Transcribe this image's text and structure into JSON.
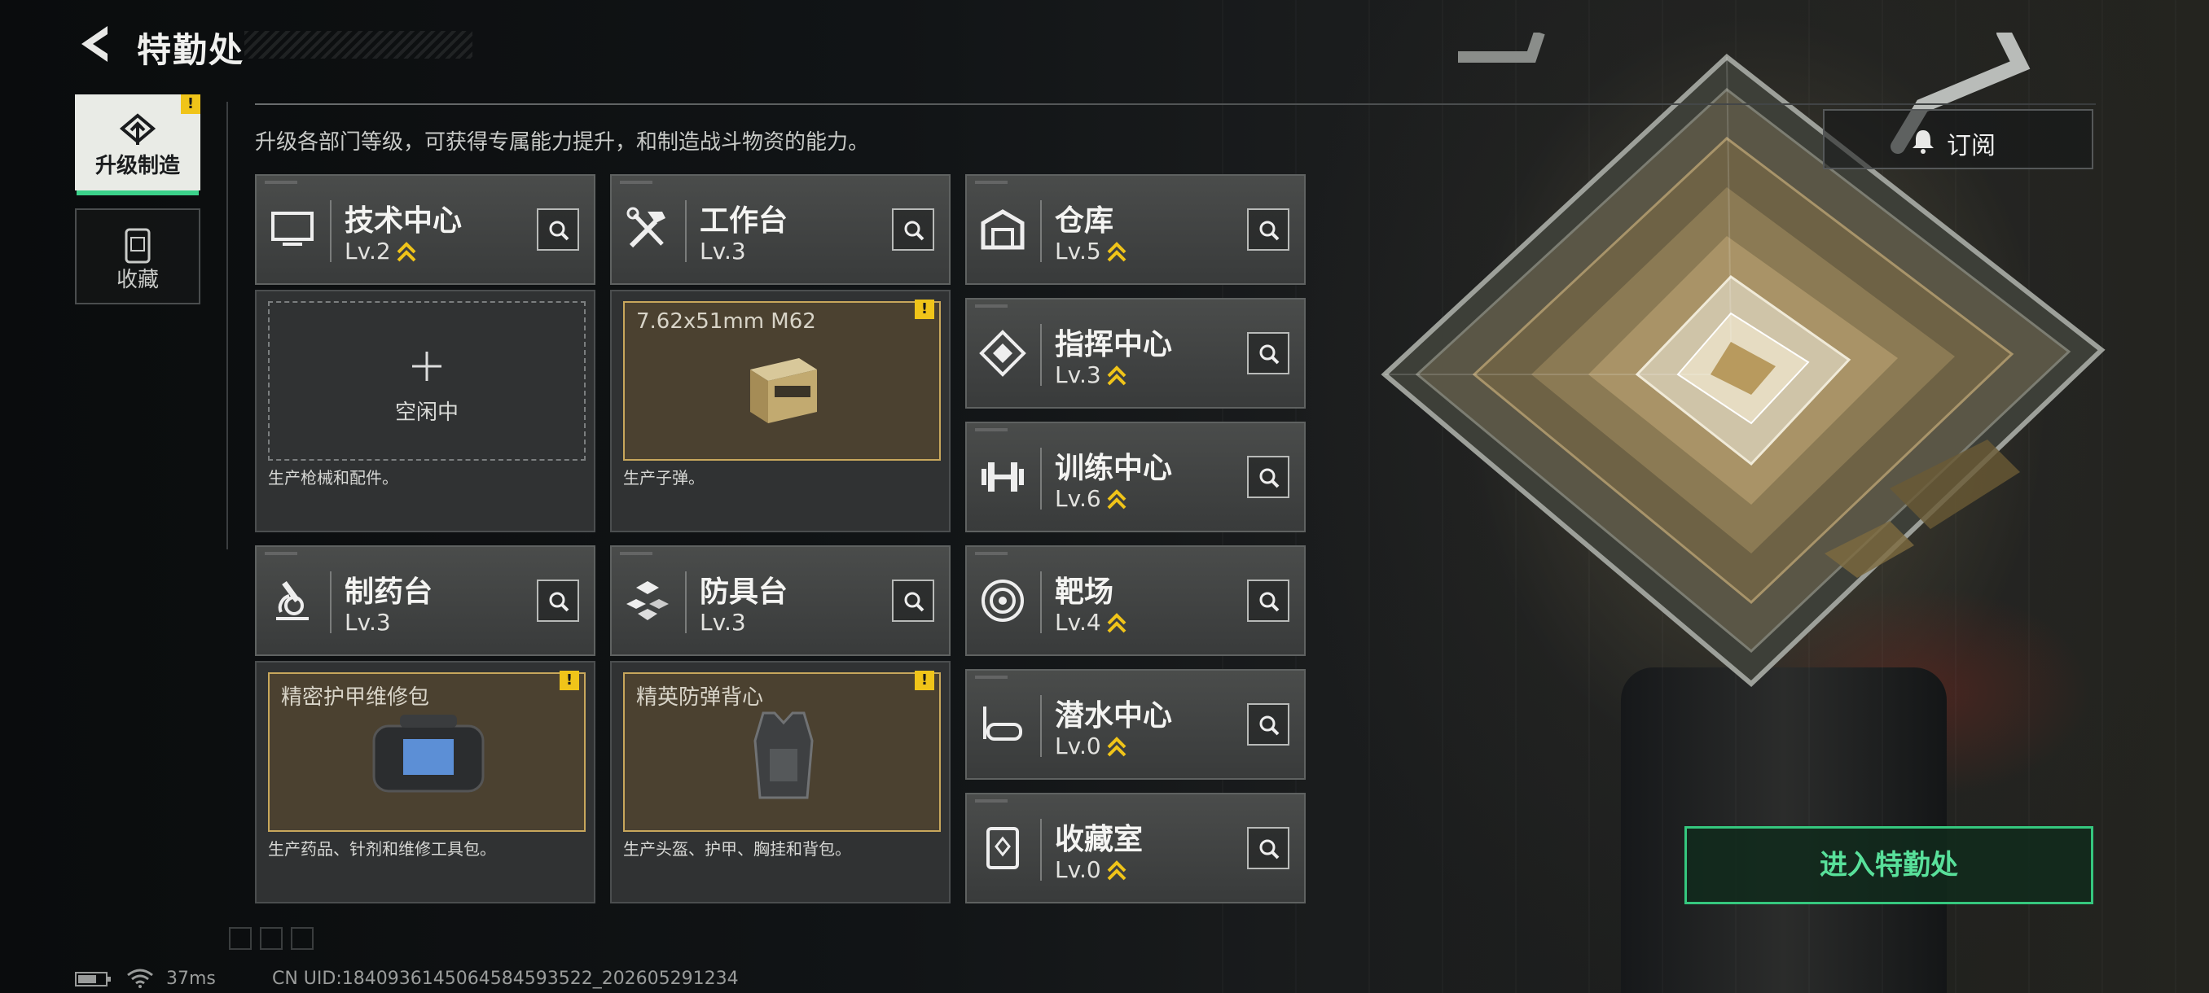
{
  "header": {
    "title": "特勤处"
  },
  "tabs": [
    {
      "label": "升级制造",
      "active": true,
      "alert": "!"
    },
    {
      "label": "收藏",
      "active": false
    }
  ],
  "subtitle": "升级各部门等级，可获得专属能力提升，和制造战斗物资的能力。",
  "subscribe_label": "订阅",
  "enter_label": "进入特勤处",
  "colors": {
    "accent_green": "#3bd18a",
    "alert_yellow": "#f0c419",
    "level_up_gold": "#f0c419",
    "production_border": "#c8a75c"
  },
  "departments": [
    {
      "name": "技术中心",
      "level": "Lv.2",
      "upgradeable": true,
      "icon": "monitor-icon"
    },
    {
      "name": "工作台",
      "level": "Lv.3",
      "upgradeable": false,
      "icon": "tools-icon"
    },
    {
      "name": "仓库",
      "level": "Lv.5",
      "upgradeable": true,
      "icon": "warehouse-icon"
    },
    {
      "name": "指挥中心",
      "level": "Lv.3",
      "upgradeable": true,
      "icon": "command-icon"
    },
    {
      "name": "训练中心",
      "level": "Lv.6",
      "upgradeable": true,
      "icon": "dumbbell-icon"
    },
    {
      "name": "制药台",
      "level": "Lv.3",
      "upgradeable": false,
      "icon": "microscope-icon"
    },
    {
      "name": "防具台",
      "level": "Lv.3",
      "upgradeable": false,
      "icon": "armor-blocks-icon"
    },
    {
      "name": "靶场",
      "level": "Lv.4",
      "upgradeable": true,
      "icon": "target-icon"
    },
    {
      "name": "潜水中心",
      "level": "Lv.0",
      "upgradeable": true,
      "icon": "diving-mask-icon"
    },
    {
      "name": "收藏室",
      "level": "Lv.0",
      "upgradeable": true,
      "icon": "collection-icon"
    }
  ],
  "production": {
    "tech": {
      "status": "空闲中",
      "desc": "生产枪械和配件。"
    },
    "workbench": {
      "item": "7.62x51mm M62",
      "desc": "生产子弹。",
      "alert": "!"
    },
    "pharmacy": {
      "item": "精密护甲维修包",
      "desc": "生产药品、针剂和维修工具包。",
      "alert": "!"
    },
    "armor": {
      "item": "精英防弹背心",
      "desc": "生产头盔、护甲、胸挂和背包。",
      "alert": "!"
    }
  },
  "status_bar": {
    "ping": "37ms",
    "uid": "CN UID:1840936145064584593522_202605291234"
  }
}
